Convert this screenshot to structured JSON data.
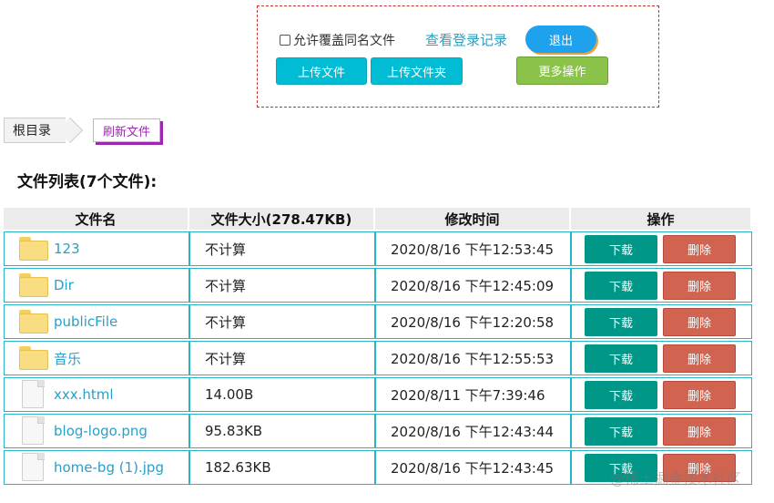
{
  "panel": {
    "overwrite_label": "允许覆盖同名文件",
    "login_history_link": "查看登录记录",
    "logout_label": "退出",
    "upload_file_label": "上传文件",
    "upload_folder_label": "上传文件夹",
    "more_actions_label": "更多操作"
  },
  "breadcrumb": {
    "root_label": "根目录"
  },
  "refresh_label": "刷新文件",
  "list_title": "文件列表(7个文件):",
  "table": {
    "headers": {
      "name": "文件名",
      "size": "文件大小(278.47KB)",
      "time": "修改时间",
      "action": "操作"
    },
    "download_label": "下载",
    "delete_label": "删除",
    "rows": [
      {
        "name": "123",
        "type": "folder",
        "size": "不计算",
        "time": "2020/8/16 下午12:53:45"
      },
      {
        "name": "Dir",
        "type": "folder",
        "size": "不计算",
        "time": "2020/8/16 下午12:45:09"
      },
      {
        "name": "publicFile",
        "type": "folder",
        "size": "不计算",
        "time": "2020/8/16 下午12:20:58"
      },
      {
        "name": "音乐",
        "type": "folder",
        "size": "不计算",
        "time": "2020/8/16 下午12:55:53"
      },
      {
        "name": "xxx.html",
        "type": "file",
        "size": "14.00B",
        "time": "2020/8/11 下午7:39:46"
      },
      {
        "name": "blog-logo.png",
        "type": "file",
        "size": "95.83KB",
        "time": "2020/8/16 下午12:43:44"
      },
      {
        "name": "home-bg (1).jpg",
        "type": "file",
        "size": "182.63KB",
        "time": "2020/8/16 下午12:43:45"
      }
    ]
  },
  "watermark": "@稀土掘金技术社区",
  "colors": {
    "link": "#2a9fc8",
    "upload": "#00bcd4",
    "logout": "#1fa2ee",
    "more": "#8bc34a",
    "download": "#009688",
    "delete": "#d06450",
    "table_border": "#2ab4c8"
  }
}
